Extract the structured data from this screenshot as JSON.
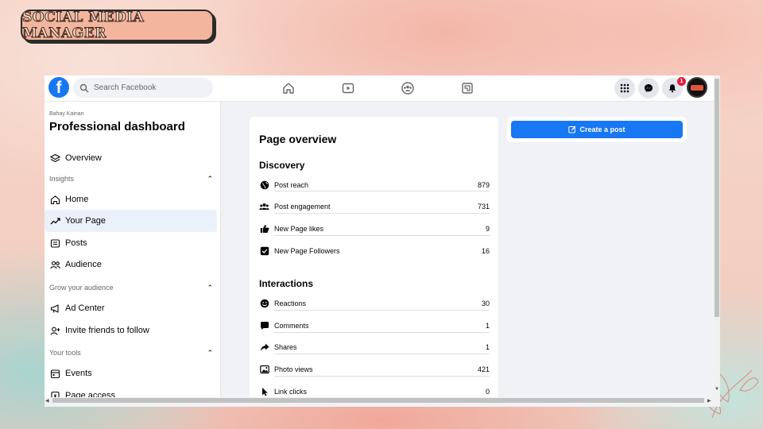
{
  "badge": {
    "title": "SOCIAL MEDIA MANAGER"
  },
  "topbar": {
    "logo_letter": "f",
    "search_placeholder": "Search Facebook",
    "nav_icons": [
      "home-icon",
      "watch-icon",
      "groups-icon",
      "gaming-icon"
    ],
    "right_icons": [
      "menu-grid-icon",
      "messenger-icon",
      "bell-icon"
    ],
    "notification_count": "1"
  },
  "sidebar": {
    "owner": "Bahay Kainan",
    "title": "Professional dashboard",
    "overview": "Overview",
    "sections": [
      {
        "label": "Insights",
        "items": [
          "Home",
          "Your Page",
          "Posts",
          "Audience"
        ]
      },
      {
        "label": "Grow your audience",
        "items": [
          "Ad Center",
          "Invite friends to follow"
        ]
      },
      {
        "label": "Your tools",
        "items": [
          "Events",
          "Page access"
        ]
      }
    ],
    "active_item": "Your Page"
  },
  "overview": {
    "title": "Page overview",
    "discovery": {
      "heading": "Discovery",
      "rows": [
        {
          "name": "Post reach",
          "value": "879",
          "icon": "globe-icon"
        },
        {
          "name": "Post engagement",
          "value": "731",
          "icon": "people-icon"
        },
        {
          "name": "New Page likes",
          "value": "9",
          "icon": "thumbs-up-icon"
        },
        {
          "name": "New Page Followers",
          "value": "16",
          "icon": "check-square-icon"
        }
      ]
    },
    "interactions": {
      "heading": "Interactions",
      "rows": [
        {
          "name": "Reactions",
          "value": "30",
          "icon": "smiley-icon"
        },
        {
          "name": "Comments",
          "value": "1",
          "icon": "comment-icon"
        },
        {
          "name": "Shares",
          "value": "1",
          "icon": "share-icon"
        },
        {
          "name": "Photo views",
          "value": "421",
          "icon": "photo-icon"
        },
        {
          "name": "Link clicks",
          "value": "0",
          "icon": "cursor-icon"
        }
      ]
    }
  },
  "actions": {
    "create_post": "Create a post"
  },
  "colors": {
    "facebook_blue": "#1877f2",
    "notification_red": "#e41e3f",
    "active_row": "#ebf1fb"
  }
}
